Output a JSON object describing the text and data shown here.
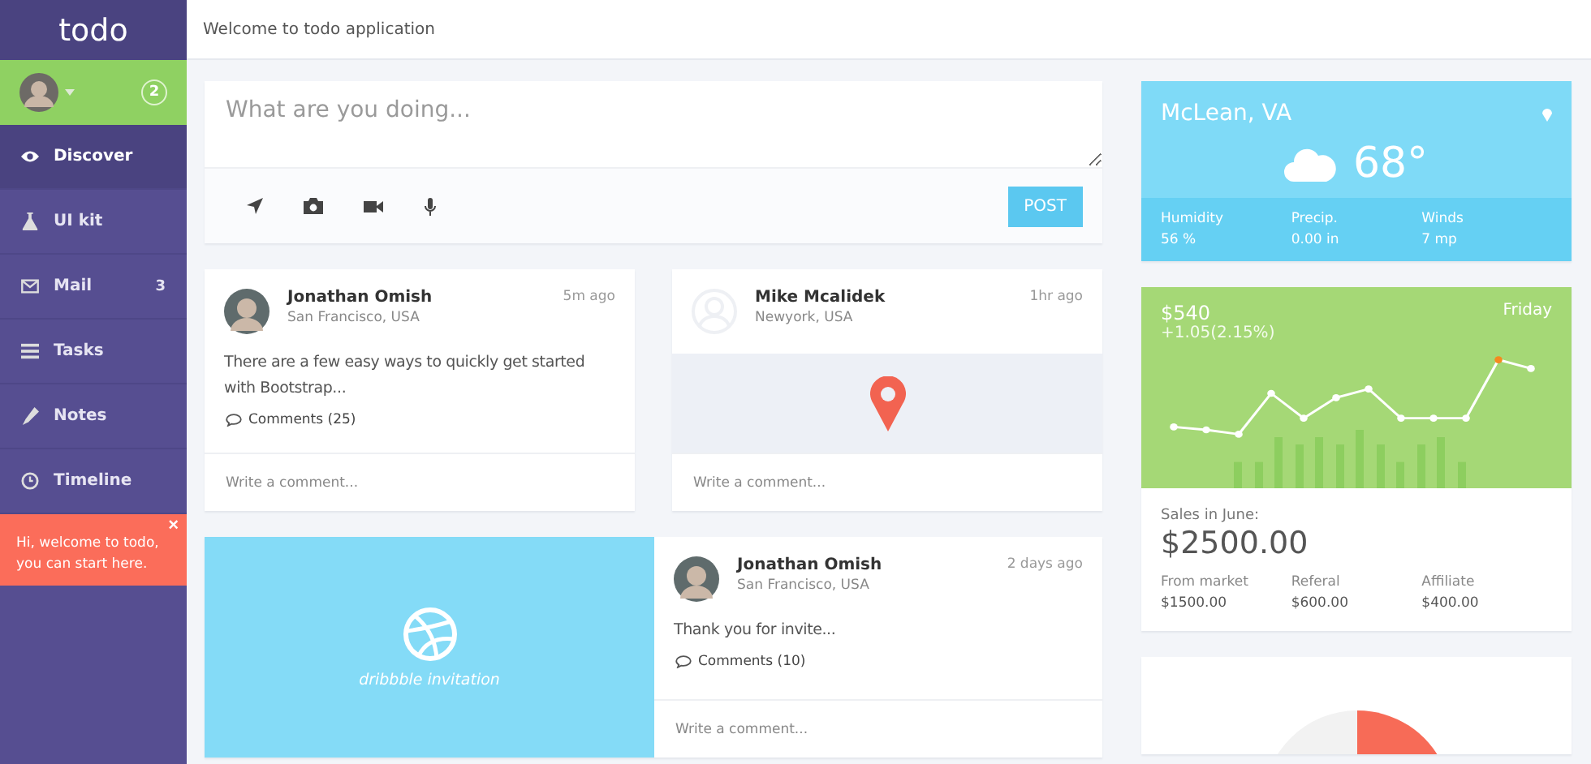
{
  "app": {
    "title": "todo"
  },
  "header": {
    "text": "Welcome to todo application"
  },
  "user": {
    "badge": "2"
  },
  "nav": [
    {
      "label": "Discover",
      "selected": true
    },
    {
      "label": "UI kit",
      "selected": false
    },
    {
      "label": "Mail",
      "selected": false,
      "count": "3"
    },
    {
      "label": "Tasks",
      "selected": false
    },
    {
      "label": "Notes",
      "selected": false
    },
    {
      "label": "Timeline",
      "selected": false
    }
  ],
  "alert": {
    "text": "Hi, welcome to todo, you can start here.",
    "close": "×"
  },
  "composer": {
    "placeholder": "What are you doing...",
    "button": "POST"
  },
  "posts": [
    {
      "kind": "text",
      "author": "Jonathan Omish",
      "location": "San Francisco, USA",
      "time": "5m ago",
      "text": "There are a few easy ways to quickly get started with Bootstrap...",
      "comments": "Comments (25)",
      "comment_placeholder": "Write a comment..."
    },
    {
      "kind": "map",
      "author": "Mike Mcalidek",
      "location": "Newyork, USA",
      "time": "1hr ago",
      "comment_placeholder": "Write a comment..."
    },
    {
      "kind": "invite",
      "invite_label": "dribbble invitation",
      "author": "Jonathan Omish",
      "location": "San Francisco, USA",
      "time": "2 days ago",
      "text": "Thank you for invite...",
      "comments": "Comments (10)",
      "comment_placeholder": "Write a comment..."
    }
  ],
  "weather": {
    "city": "McLean, VA",
    "temp": "68°",
    "stats": [
      {
        "label": "Humidity",
        "value": "56 %"
      },
      {
        "label": "Precip.",
        "value": "0.00 in"
      },
      {
        "label": "Winds",
        "value": "7 mp"
      }
    ]
  },
  "sales": {
    "price": "$540",
    "change": "+1.05(2.15%)",
    "day": "Friday",
    "title": "Sales in June:",
    "total": "$2500.00",
    "stats": [
      {
        "label": "From market",
        "value": "$1500.00"
      },
      {
        "label": "Referal",
        "value": "$600.00"
      },
      {
        "label": "Affiliate",
        "value": "$400.00"
      }
    ]
  }
}
